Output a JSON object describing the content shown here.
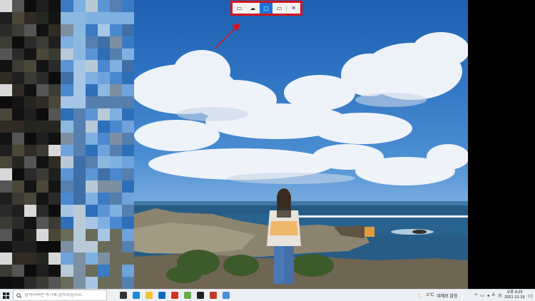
{
  "snip_toolbar": {
    "buttons": [
      {
        "name": "rectangular-snip",
        "icon": "rectangle-snip-icon",
        "glyph": "▭",
        "active": false
      },
      {
        "name": "freeform-snip",
        "icon": "freeform-snip-icon",
        "glyph": "☁",
        "active": false
      },
      {
        "name": "window-snip",
        "icon": "window-snip-icon",
        "glyph": "▢",
        "active": true
      },
      {
        "name": "fullscreen-snip",
        "icon": "fullscreen-snip-icon",
        "glyph": "▭",
        "active": false
      },
      {
        "name": "close",
        "icon": "close-icon",
        "glyph": "✕",
        "active": false
      }
    ],
    "highlight_color": "#d5141e",
    "active_color": "#1a73d9"
  },
  "annotation": {
    "arrow_color": "#d5141e"
  },
  "taskbar": {
    "search_placeholder": "검색하려면 여기에 입력하십시오.",
    "start_icon": "windows-logo-icon",
    "search_icon": "search-icon",
    "pinned_apps": [
      {
        "name": "task-view",
        "icon": "task-view-icon",
        "color": "#333333"
      },
      {
        "name": "edge",
        "icon": "edge-icon",
        "color": "#1c8ad8"
      },
      {
        "name": "file-explorer",
        "icon": "folder-icon",
        "color": "#f1c232"
      },
      {
        "name": "mail",
        "icon": "mail-icon",
        "color": "#0f6cbd"
      },
      {
        "name": "chrome",
        "icon": "chrome-icon",
        "color": "#d93025"
      },
      {
        "name": "app-stack",
        "icon": "stack-icon",
        "color": "#6aa84f"
      },
      {
        "name": "terminal",
        "icon": "terminal-icon",
        "color": "#222222"
      },
      {
        "name": "photos",
        "icon": "photos-icon",
        "color": "#c0392b"
      },
      {
        "name": "snip-sketch",
        "icon": "scissors-icon",
        "color": "#4a90d9"
      }
    ],
    "weather": {
      "icon": "moon-icon",
      "temp": "-1°C",
      "desc": "대체로 맑음"
    },
    "tray_icons": [
      "chevron-up-icon",
      "network-icon",
      "volume-icon",
      "ime-icon"
    ],
    "ime_label": "A",
    "keyboard_label": "가",
    "clock": {
      "time": "오후 8:25",
      "date": "2021-12-19"
    },
    "notification_icon": "notification-icon"
  }
}
